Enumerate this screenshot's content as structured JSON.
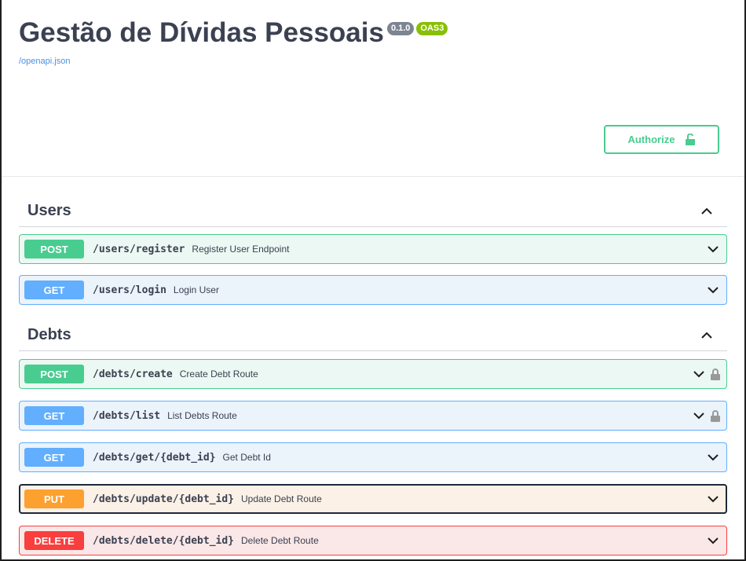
{
  "info": {
    "title": "Gestão de Dívidas Pessoais",
    "version": "0.1.0",
    "oas": "OAS3",
    "spec_link": "/openapi.json"
  },
  "authorize": {
    "label": "Authorize",
    "icon": "lock-open-icon"
  },
  "colors": {
    "post": "#49cc90",
    "get": "#61affe",
    "put": "#fca130",
    "delete": "#f93e3e"
  },
  "tags": [
    {
      "name": "Users",
      "operations": [
        {
          "method": "POST",
          "path": "/users/register",
          "summary": "Register User Endpoint",
          "locked": false
        },
        {
          "method": "GET",
          "path": "/users/login",
          "summary": "Login User",
          "locked": false
        }
      ]
    },
    {
      "name": "Debts",
      "operations": [
        {
          "method": "POST",
          "path": "/debts/create",
          "summary": "Create Debt Route",
          "locked": true
        },
        {
          "method": "GET",
          "path": "/debts/list",
          "summary": "List Debts Route",
          "locked": true
        },
        {
          "method": "GET",
          "path": "/debts/get/{debt_id}",
          "summary": "Get Debt Id",
          "locked": false
        },
        {
          "method": "PUT",
          "path": "/debts/update/{debt_id}",
          "summary": "Update Debt Route",
          "locked": false
        },
        {
          "method": "DELETE",
          "path": "/debts/delete/{debt_id}",
          "summary": "Delete Debt Route",
          "locked": false
        }
      ]
    }
  ]
}
